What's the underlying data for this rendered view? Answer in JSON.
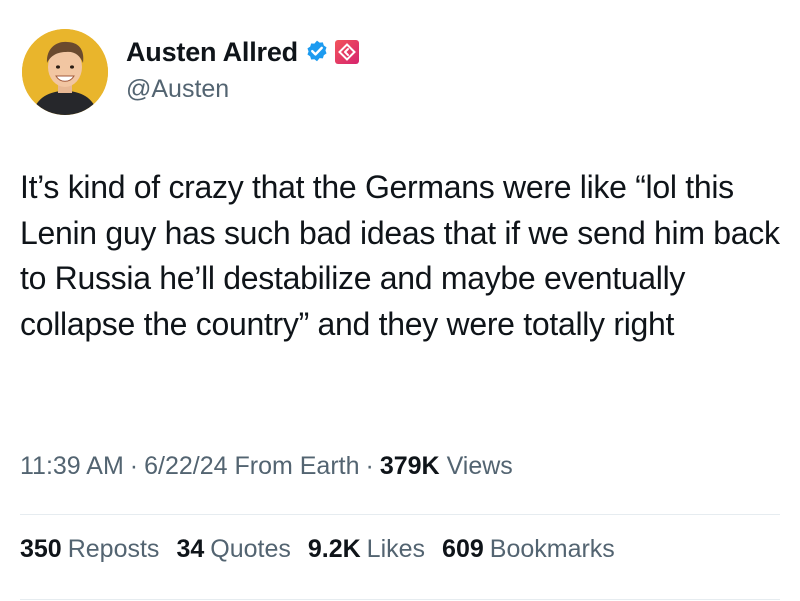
{
  "author": {
    "display_name": "Austen Allred",
    "handle": "@Austen",
    "avatar_icon": "person-avatar-icon",
    "verified_icon": "blue-checkmark-icon",
    "affiliate_badge_icon": "affiliate-badge-icon",
    "verified_color": "#1d9bf0"
  },
  "tweet": {
    "text": "It’s kind of crazy that the Germans were like “lol this Lenin guy has such bad ideas that if we send him back to Russia he’ll destabilize and maybe eventually collapse the country” and they were totally right"
  },
  "meta": {
    "time": "11:39 AM",
    "date": "6/22/24",
    "source": "From Earth",
    "views_count": "379K",
    "views_label": "Views",
    "separator": "·"
  },
  "stats": {
    "reposts": {
      "count": "350",
      "label": "Reposts"
    },
    "quotes": {
      "count": "34",
      "label": "Quotes"
    },
    "likes": {
      "count": "9.2K",
      "label": "Likes"
    },
    "bookmarks": {
      "count": "609",
      "label": "Bookmarks"
    }
  },
  "colors": {
    "text_primary": "#0f1419",
    "text_secondary": "#536471",
    "divider": "#e6ecf0",
    "avatar_bg": "#e9b52c"
  }
}
